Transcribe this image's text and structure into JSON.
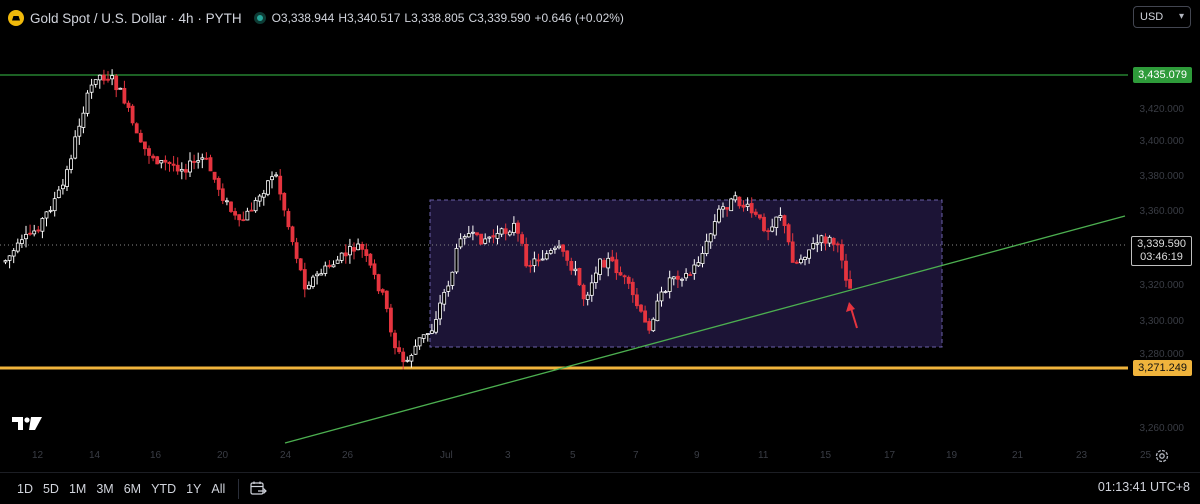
{
  "header": {
    "symbol_title": "Gold Spot / U.S. Dollar · 4h · PYTH",
    "ohlc": [
      {
        "key": "O",
        "value": "3,338.944"
      },
      {
        "key": "H",
        "value": "3,340.517"
      },
      {
        "key": "L",
        "value": "3,338.805"
      },
      {
        "key": "C",
        "value": "3,339.590"
      }
    ],
    "change": "+0.646 (+0.02%)"
  },
  "currency_select": {
    "value": "USD"
  },
  "price_tags": {
    "resistance": "3,435.079",
    "support": "3,271.249",
    "current_price": "3,339.590",
    "countdown": "03:46:19"
  },
  "price_axis_labels": [
    "3,420.000",
    "3,400.000",
    "3,380.000",
    "3,360.000",
    "3,320.000",
    "3,300.000",
    "3,280.000",
    "3,260.000"
  ],
  "time_axis_labels": [
    "12",
    "14",
    "16",
    "20",
    "24",
    "26",
    "Jul",
    "3",
    "5",
    "7",
    "9",
    "11",
    "15",
    "17",
    "19",
    "21",
    "23",
    "25"
  ],
  "range_buttons": [
    "1D",
    "5D",
    "1M",
    "3M",
    "6M",
    "YTD",
    "1Y",
    "All"
  ],
  "icons": {
    "symbol": "gold-coin-icon",
    "market_status": "market-open-dot-icon",
    "date_range": "calendar-range-icon",
    "settings": "gear-icon",
    "logo": "tradingview-logo-icon",
    "annotation": "red-arrow-icon"
  },
  "clock": "01:13:41 UTC+8",
  "colors": {
    "bull": "#ffffff",
    "bear": "#e5343f",
    "resistance_line": "#2e9b3a",
    "support_line": "#f0b43c",
    "trendline": "#4caf50",
    "range_box": "#1c1436"
  },
  "chart_data": {
    "type": "candlestick",
    "timeframe": "4h",
    "horizontal_levels": [
      3435.079,
      3271.249
    ],
    "current_price": 3339.59,
    "annotations": [
      "ascending trendline",
      "consolidation range box",
      "red arrow at trendline touch"
    ]
  }
}
